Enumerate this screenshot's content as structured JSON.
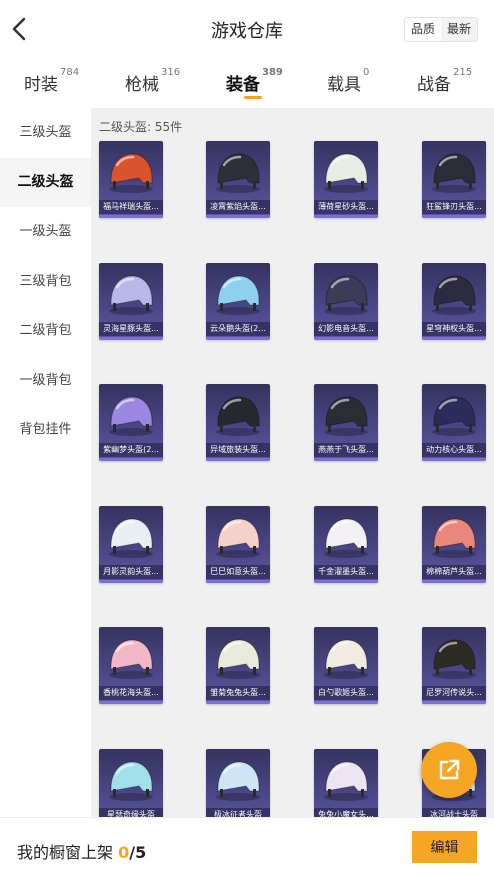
{
  "header": {
    "title": "游戏仓库",
    "sort_options": [
      "品质",
      "最新"
    ],
    "sort_active": 0
  },
  "tabs": [
    {
      "label": "时装",
      "count": "784"
    },
    {
      "label": "枪械",
      "count": "316"
    },
    {
      "label": "装备",
      "count": "389"
    },
    {
      "label": "载具",
      "count": "0"
    },
    {
      "label": "战备",
      "count": "215"
    }
  ],
  "active_tab": 2,
  "sidebar": {
    "items": [
      "三级头盔",
      "二级头盔",
      "一级头盔",
      "三级背包",
      "二级背包",
      "一级背包",
      "背包挂件"
    ],
    "active": 1
  },
  "section": {
    "title": "二级头盔: 55件"
  },
  "items": [
    {
      "name": "福马祥瑞头盔...",
      "color": "#d9542f"
    },
    {
      "name": "凌霄紫焰头盔...",
      "color": "#2f2f3a"
    },
    {
      "name": "薄荷星砂头盔...",
      "color": "#e7ede4"
    },
    {
      "name": "狂鲨锋刃头盔...",
      "color": "#2a2d38"
    },
    {
      "name": "灵海星豚头盔...",
      "color": "#b9b7e8"
    },
    {
      "name": "云朵鹅头盔(2...",
      "color": "#8fd0f0"
    },
    {
      "name": "幻影电音头盔...",
      "color": "#3c3b58"
    },
    {
      "name": "星穹神权头盔...",
      "color": "#2d2b40"
    },
    {
      "name": "紫幽梦头盔(2...",
      "color": "#9b86e0"
    },
    {
      "name": "异域旅装头盔...",
      "color": "#262a30"
    },
    {
      "name": "燕燕于飞头盔...",
      "color": "#2b2d34"
    },
    {
      "name": "动力核心头盔...",
      "color": "#2a2d5a"
    },
    {
      "name": "月影灵韵头盔...",
      "color": "#e9eef2"
    },
    {
      "name": "巳巳如意头盔...",
      "color": "#f2d2c9"
    },
    {
      "name": "千金濯墨头盔...",
      "color": "#f3f0f4"
    },
    {
      "name": "棉棉葫芦头盔...",
      "color": "#e9877a"
    },
    {
      "name": "香桃花海头盔...",
      "color": "#f3b8c7"
    },
    {
      "name": "雏菊兔兔头盔...",
      "color": "#eaeadc"
    },
    {
      "name": "白勺歌姬头盔...",
      "color": "#f1ece2"
    },
    {
      "name": "尼罗河传说头...",
      "color": "#2e2b26"
    },
    {
      "name": "星瑟奇缘头盔",
      "color": "#9fe0e9"
    },
    {
      "name": "极冰征者头盔",
      "color": "#cde6f5"
    },
    {
      "name": "兔兔小魔女头...",
      "color": "#ece4f2"
    },
    {
      "name": "冰河战士头盔",
      "color": "#d8ecf5"
    }
  ],
  "footer": {
    "label": "我的橱窗上架 ",
    "count": "0",
    "max": "/5",
    "edit_label": "编辑"
  },
  "accent_color": "#f5a623"
}
